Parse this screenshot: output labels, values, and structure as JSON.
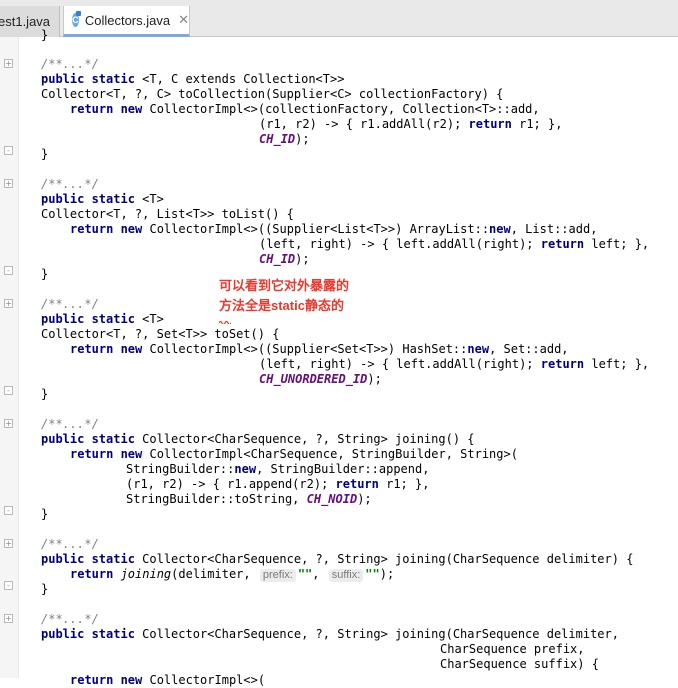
{
  "tabs": [
    {
      "label": "est1.java",
      "active": false
    },
    {
      "label": "Collectors.java",
      "active": true
    }
  ],
  "tab_icon_letter": "C",
  "close_glyph": "✕",
  "annotation": {
    "line1": "可以看到它对外暴露的",
    "line2": "方法全是static静态的"
  },
  "code": {
    "l0": "}",
    "l1": "/**...*/",
    "l2_a": "public static ",
    "l2_b": "<T, C extends Collection<T>>",
    "l3": "Collector<T, ?, C> toCollection(Supplier<C> collectionFactory) {",
    "l4_a": "return new ",
    "l4_b": "CollectorImpl<>(collectionFactory, Collection<T>::add,",
    "l5_a": "(r1, r2) -> { r1.addAll(r2); ",
    "l5_b": "return",
    "l5_c": " r1; },",
    "l6": "CH_ID",
    "l7": "}",
    "l8": "/**...*/",
    "l9_a": "public static ",
    "l9_b": "<T>",
    "l10": "Collector<T, ?, List<T>> toList() {",
    "l11_a": "return new ",
    "l11_b": "CollectorImpl<>((Supplier<List<T>>) ArrayList::",
    "l11_c": "new",
    "l11_d": ", List::add,",
    "l12_a": "(left, right) -> { left.addAll(right); ",
    "l12_b": "return",
    "l12_c": " left; },",
    "l13": "CH_ID",
    "l14": "}",
    "l15": "/**...*/",
    "l16_a": "public static ",
    "l16_b": "<T>",
    "l17": "Collector<T, ?, Set<T>> toSet() {",
    "l18_a": "return new ",
    "l18_b": "CollectorImpl<>((Supplier<Set<T>>) HashSet::",
    "l18_c": "new",
    "l18_d": ", Set::add,",
    "l19_a": "(left, right) -> { left.addAll(right); ",
    "l19_b": "return",
    "l19_c": " left; },",
    "l20": "CH_UNORDERED_ID",
    "l21": "}",
    "l22": "/**...*/",
    "l23_a": "public static ",
    "l23_b": "Collector<CharSequence, ?, String> joining() {",
    "l24_a": "return new ",
    "l24_b": "CollectorImpl<CharSequence, StringBuilder, String>(",
    "l25_a": "StringBuilder::",
    "l25_b": "new",
    "l25_c": ", StringBuilder::append,",
    "l26_a": "(r1, r2) -> { r1.append(r2); ",
    "l26_b": "return",
    "l26_c": " r1; },",
    "l27_a": "StringBuilder::toString, ",
    "l27_b": "CH_NOID",
    "l28": "}",
    "l29": "/**...*/",
    "l30_a": "public static ",
    "l30_b": "Collector<CharSequence, ?, String> joining(CharSequence delimiter) {",
    "l31_a": "return ",
    "l31_b": "joining",
    "l31_c": "(delimiter, ",
    "hint_prefix": "prefix:",
    "str1": "\"\"",
    "hint_suffix": "suffix:",
    "str2": "\"\"",
    "l31_end": ");",
    "l32": "}",
    "l33": "/**...*/",
    "l34_a": "public static ",
    "l34_b": "Collector<CharSequence, ?, String> joining(CharSequence delimiter,",
    "l35": "CharSequence prefix,",
    "l36": "CharSequence suffix) {",
    "l37_a": "return new ",
    "l37_b": "CollectorImpl<>("
  }
}
